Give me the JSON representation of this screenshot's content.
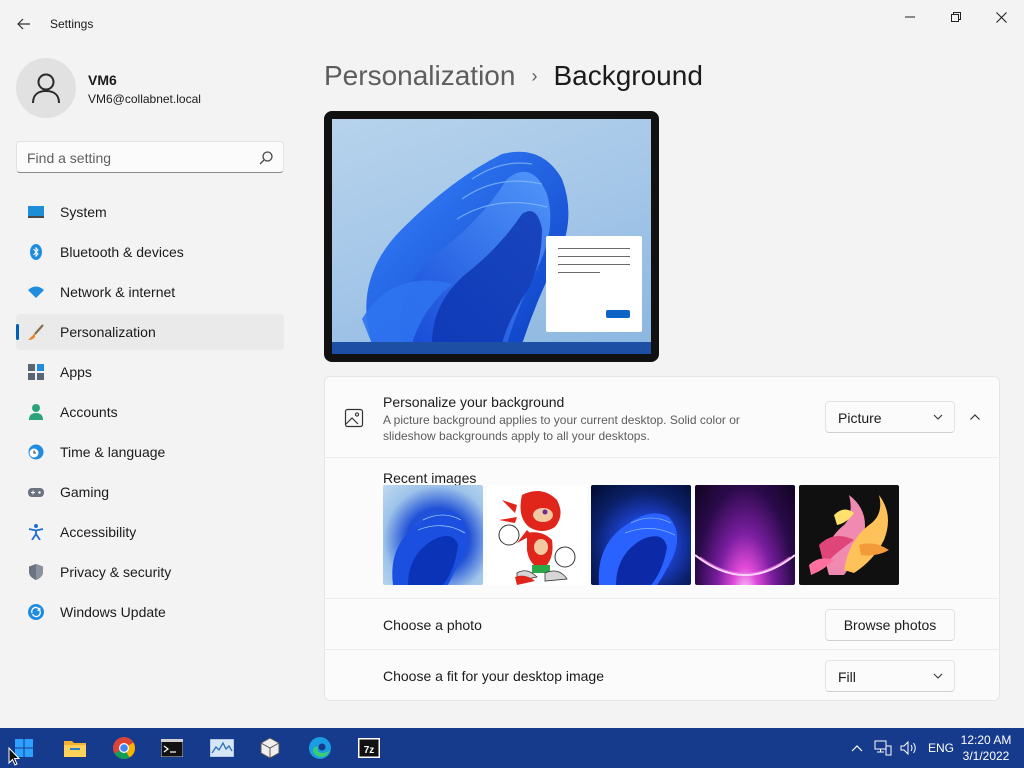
{
  "window": {
    "title": "Settings",
    "back_icon": "back-arrow-icon",
    "minimize_icon": "minimize-icon",
    "maximize_icon": "restore-icon",
    "close_icon": "close-icon"
  },
  "user": {
    "name": "VM6",
    "email": "VM6@collabnet.local",
    "avatar_icon": "person-icon"
  },
  "search": {
    "placeholder": "Find a setting",
    "icon": "search-icon"
  },
  "sidebar": {
    "items": [
      {
        "label": "System",
        "icon": "monitor-icon",
        "selected": false
      },
      {
        "label": "Bluetooth & devices",
        "icon": "bluetooth-icon",
        "selected": false
      },
      {
        "label": "Network & internet",
        "icon": "wifi-icon",
        "selected": false
      },
      {
        "label": "Personalization",
        "icon": "paintbrush-icon",
        "selected": true
      },
      {
        "label": "Apps",
        "icon": "apps-icon",
        "selected": false
      },
      {
        "label": "Accounts",
        "icon": "accounts-icon",
        "selected": false
      },
      {
        "label": "Time & language",
        "icon": "globe-clock-icon",
        "selected": false
      },
      {
        "label": "Gaming",
        "icon": "gamepad-icon",
        "selected": false
      },
      {
        "label": "Accessibility",
        "icon": "accessibility-icon",
        "selected": false
      },
      {
        "label": "Privacy & security",
        "icon": "shield-icon",
        "selected": false
      },
      {
        "label": "Windows Update",
        "icon": "update-icon",
        "selected": false
      }
    ]
  },
  "breadcrumb": {
    "parent": "Personalization",
    "separator": "›",
    "current": "Background"
  },
  "background": {
    "title": "Personalize your background",
    "description": "A picture background applies to your current desktop. Solid color or slideshow backgrounds apply to all your desktops.",
    "type_value": "Picture",
    "recent_label": "Recent images",
    "recent_images": [
      "bloom-light",
      "knuckles",
      "bloom-dark",
      "purple-glow",
      "abstract-ribbons"
    ],
    "choose_photo_label": "Choose a photo",
    "browse_label": "Browse photos",
    "fit_label": "Choose a fit for your desktop image",
    "fit_value": "Fill"
  },
  "taskbar": {
    "apps": [
      "windows-start-icon",
      "file-explorer-icon",
      "chrome-icon",
      "terminal-icon",
      "resource-monitor-icon",
      "virtualbox-icon",
      "edge-icon",
      "7zip-icon"
    ],
    "language": "ENG",
    "time": "12:20 AM",
    "date": "3/1/2022"
  },
  "colors": {
    "accent": "#005fb8",
    "taskbar": "#163a8c"
  }
}
